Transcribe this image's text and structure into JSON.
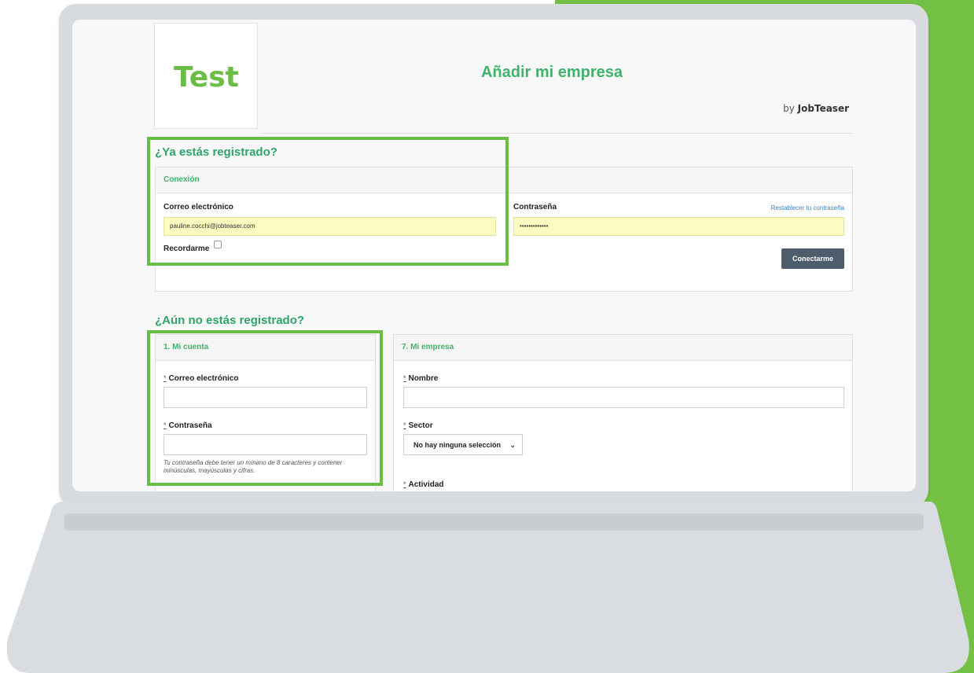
{
  "colors": {
    "accent_green": "#6abd45",
    "title_green": "#3fb36b",
    "button_dark": "#4e5d6c",
    "autofill_yellow": "#fafcc0",
    "link_blue": "#3d7fc6"
  },
  "header": {
    "logo_text": "Test",
    "page_title": "Añadir mi empresa",
    "by_prefix": "by",
    "by_brand": "JobTeaser"
  },
  "login": {
    "section_title": "¿Ya estás registrado?",
    "panel_title": "Conexión",
    "email_label": "Correo electrónico",
    "email_value": "pauline.cocchi@jobteaser.com",
    "password_label": "Contraseña",
    "password_value": "•••••••••••••",
    "reset_link": "Restablecer tu contraseña",
    "remember_label": "Recordarme",
    "submit_label": "Conectarme"
  },
  "register": {
    "section_title": "¿Aún no estás registrado?",
    "account": {
      "panel_title": "1. Mi cuenta",
      "required_mark": "*",
      "email_label": "Correo electrónico",
      "password_label": "Contraseña",
      "password_hint": "Tu contraseña debe tener un mínimo de 8 caracteres y contener minúsculas, mayúsculas y cifras."
    },
    "company": {
      "panel_title": "7. Mi empresa",
      "required_mark": "*",
      "name_label": "Nombre",
      "sector_label": "Sector",
      "sector_selected": "No hay ninguna selección",
      "activity_label": "Actividad"
    }
  }
}
